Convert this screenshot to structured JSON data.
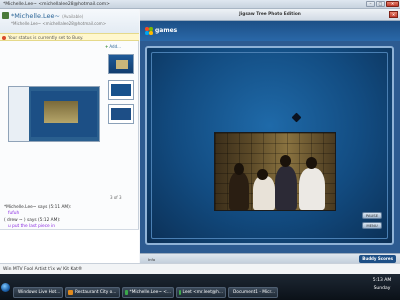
{
  "window": {
    "title": "*Michelle.Lee~ <michellalee28@hotmail.com>",
    "controls": [
      "–",
      "□",
      "✕"
    ]
  },
  "contact": {
    "name": "*Michelle.Lee~",
    "status": "(Available)",
    "email": "*Michelle.Lee~ <michellalee28@hotmail.com>"
  },
  "busy_notice": "Your status is currently set to Busy.",
  "sidebar": {
    "add_label": "Add..."
  },
  "page_indicator": "3 of 3",
  "chat": {
    "line1": "*Michelle.Lee~ says (5:11 AM):",
    "line2": "fufuh",
    "line3": "( drew ~ ) says (5:12 AM):",
    "line4": "u put the last piece in",
    "last_received": "Last message received at 5:11 AM on 8/23/2009."
  },
  "ad": "Win MTV Fool Artist t'ix w/ Kit Kat®",
  "game": {
    "title": "Jigsaw Tree Photo Edition",
    "brand": "games",
    "button1": "PAUSE",
    "button2": "MENU",
    "footer_text": "Info",
    "footer_badge": "Buddy Scores"
  },
  "taskbar": {
    "tasks": [
      "Windows Live Hot...",
      "Restaurant City o...",
      "*Michelle.Lee~ <...",
      "Leet <mr.leet@h...",
      "Document1 - Micr..."
    ],
    "time": "5:13 AM",
    "day": "Sunday"
  }
}
